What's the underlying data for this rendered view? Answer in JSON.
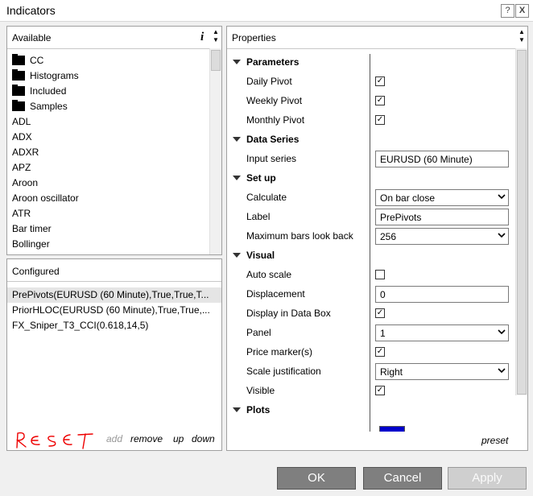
{
  "window": {
    "title": "Indicators",
    "help": "?",
    "close": "X"
  },
  "available": {
    "title": "Available",
    "info_icon": "i",
    "folders": [
      "CC",
      "Histograms",
      "Included",
      "Samples"
    ],
    "items": [
      "ADL",
      "ADX",
      "ADXR",
      "APZ",
      "Aroon",
      "Aroon oscillator",
      "ATR",
      "Bar timer",
      "Bollinger"
    ]
  },
  "configured": {
    "title": "Configured",
    "items": [
      "PrePivots(EURUSD (60 Minute),True,True,T...",
      "PriorHLOC(EURUSD (60 Minute),True,True,...",
      "FX_Sniper_T3_CCI(0.618,14,5)"
    ],
    "handwritten": "Reset",
    "actions": {
      "add": "add",
      "remove": "remove",
      "up": "up",
      "down": "down"
    }
  },
  "properties": {
    "title": "Properties",
    "preset": "preset",
    "sections": {
      "parameters": "Parameters",
      "data_series": "Data Series",
      "setup": "Set up",
      "visual": "Visual",
      "plots": "Plots"
    },
    "rows": {
      "daily_pivot": {
        "label": "Daily Pivot",
        "checked": true
      },
      "weekly_pivot": {
        "label": "Weekly Pivot",
        "checked": true
      },
      "monthly_pivot": {
        "label": "Monthly Pivot",
        "checked": true
      },
      "input_series": {
        "label": "Input series",
        "value": "EURUSD (60 Minute)"
      },
      "calculate": {
        "label": "Calculate",
        "value": "On bar close"
      },
      "label": {
        "label": "Label",
        "value": "PrePivots"
      },
      "max_bars": {
        "label": "Maximum bars look back",
        "value": "256"
      },
      "auto_scale": {
        "label": "Auto scale",
        "checked": false
      },
      "displacement": {
        "label": "Displacement",
        "value": "0"
      },
      "display_data_box": {
        "label": "Display in Data Box",
        "checked": true
      },
      "panel": {
        "label": "Panel",
        "value": "1"
      },
      "price_marker": {
        "label": "Price marker(s)",
        "checked": true
      },
      "scale_justification": {
        "label": "Scale justification",
        "value": "Right"
      },
      "visible": {
        "label": "Visible",
        "checked": true
      }
    },
    "plot_color": "#0000cc"
  },
  "buttons": {
    "ok": "OK",
    "cancel": "Cancel",
    "apply": "Apply"
  }
}
